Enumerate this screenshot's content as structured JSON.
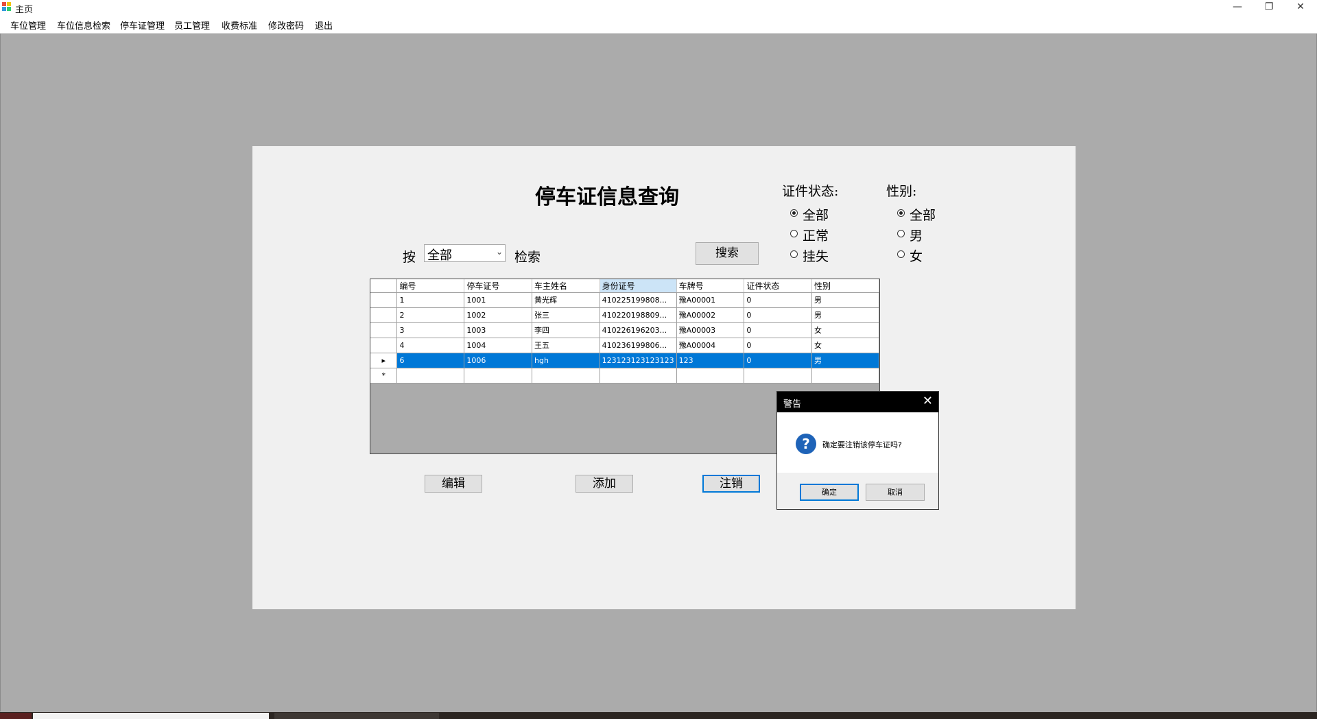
{
  "window": {
    "title": "主页",
    "controls": {
      "minimize": "—",
      "restore": "❐",
      "close": "✕"
    }
  },
  "menu": [
    "车位管理",
    "车位信息检索",
    "停车证管理",
    "员工管理",
    "收费标准",
    "修改密码",
    "退出"
  ],
  "form": {
    "heading": "停车证信息查询",
    "search": {
      "by_label": "按",
      "combo_value": "全部",
      "suffix_label": "检索",
      "search_button": "搜索"
    },
    "status_filter": {
      "label": "证件状态:",
      "options": [
        "全部",
        "正常",
        "挂失"
      ],
      "selected": "全部"
    },
    "gender_filter": {
      "label": "性别:",
      "options": [
        "全部",
        "男",
        "女"
      ],
      "selected": "全部"
    },
    "grid": {
      "columns": [
        "编号",
        "停车证号",
        "车主姓名",
        "身份证号",
        "车牌号",
        "证件状态",
        "性别"
      ],
      "rows": [
        [
          "1",
          "1001",
          "黄光辉",
          "410225199808...",
          "豫A00001",
          "0",
          "男"
        ],
        [
          "2",
          "1002",
          "张三",
          "410220198809...",
          "豫A00002",
          "0",
          "男"
        ],
        [
          "3",
          "1003",
          "李四",
          "410226196203...",
          "豫A00003",
          "0",
          "女"
        ],
        [
          "4",
          "1004",
          "王五",
          "410236199806...",
          "豫A00004",
          "0",
          "女"
        ],
        [
          "6",
          "1006",
          "hgh",
          "123123123123123",
          "123",
          "0",
          "男"
        ]
      ],
      "selected_row_marker": "▸",
      "new_row_marker": "*"
    },
    "buttons": {
      "edit": "编辑",
      "add": "添加",
      "cancel_cert": "注销"
    }
  },
  "dialog": {
    "title": "警告",
    "close": "✕",
    "icon": "question-icon",
    "icon_glyph": "?",
    "message": "确定要注销该停车证吗?",
    "ok": "确定",
    "cancel": "取消"
  },
  "colors": {
    "mdi_background": "#ababab",
    "form_background": "#f0f0f0",
    "selection": "#0078d7",
    "dialog_title": "#000000",
    "question_icon": "#1e63b8"
  }
}
